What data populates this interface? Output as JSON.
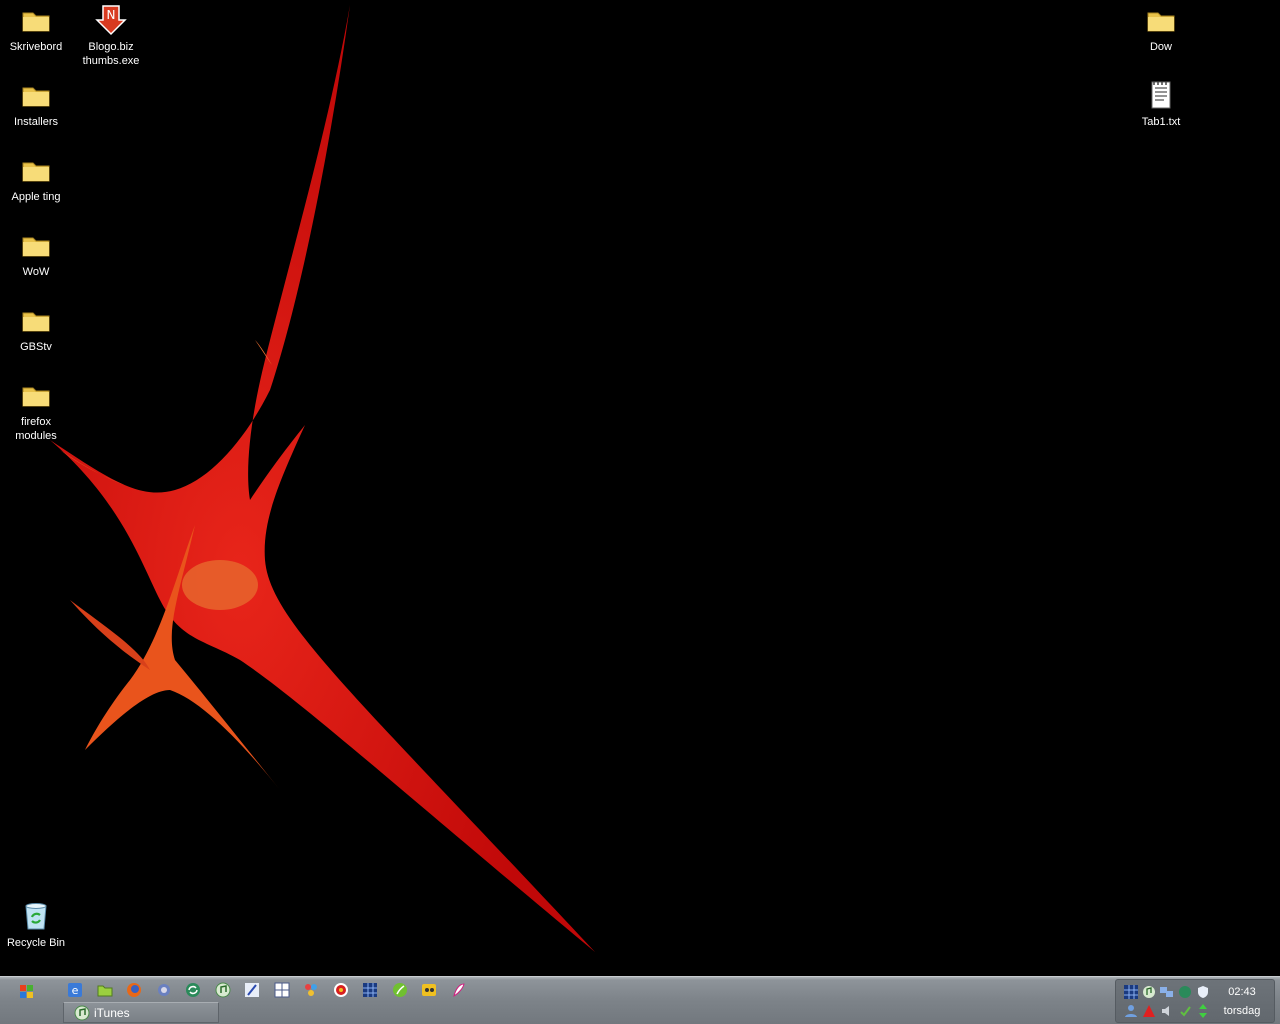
{
  "desktop": {
    "icons_left": [
      {
        "label": "Skrivebord",
        "icon": "folder-icon"
      },
      {
        "label": "Blogo.biz\nthumbs.exe",
        "icon": "app-icon"
      },
      {
        "label": "Installers",
        "icon": "folder-icon"
      },
      {
        "label": "Apple ting",
        "icon": "folder-icon"
      },
      {
        "label": "WoW",
        "icon": "folder-icon"
      },
      {
        "label": "GBStv",
        "icon": "folder-icon"
      },
      {
        "label": "firefox\nmodules",
        "icon": "folder-icon"
      }
    ],
    "icons_right": [
      {
        "label": "Dow",
        "icon": "folder-icon"
      },
      {
        "label": "Tab1.txt",
        "icon": "text-file-icon"
      }
    ],
    "recycle_bin": {
      "label": "Recycle Bin",
      "icon": "recycle-bin-icon"
    }
  },
  "taskbar": {
    "quick_launch": [
      "ie-icon",
      "folder-icon",
      "firefox-icon",
      "mail-icon",
      "sync-icon",
      "itunes-icon",
      "pen-icon",
      "calculator-icon",
      "network-icon",
      "media-icon",
      "grid-icon",
      "leaf-icon",
      "messenger-icon",
      "paint-icon"
    ],
    "tasks": [
      {
        "label": "iTunes",
        "icon": "itunes-icon"
      }
    ],
    "tray_icons": [
      "tray-grid-icon",
      "tray-itunes-icon",
      "tray-network-icon",
      "tray-sync-icon",
      "tray-shield-icon",
      "tray-user-icon",
      "tray-antivirus-icon",
      "tray-speaker-icon",
      "tray-update-icon",
      "tray-arrows-icon"
    ],
    "clock": {
      "time": "02:43",
      "day": "torsdag"
    }
  },
  "colors": {
    "wallpaper_red": "#e01010",
    "wallpaper_orange": "#f06020",
    "taskbar": "#7d8389"
  }
}
